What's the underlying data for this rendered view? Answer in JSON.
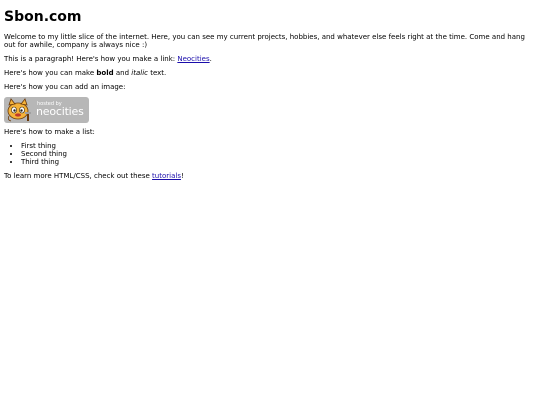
{
  "page": {
    "title": "Sbon.com",
    "intro": "Welcome to my little slice of the internet. Here, you can see my current projects, hobbies, and whatever else feels right at the time. Come and hang out for awhile, company is always nice :)",
    "paragraph_prefix": "This is a paragraph! Here's how you make a link: ",
    "link_label": "Neocities",
    "paragraph_suffix": ".",
    "bold_prefix": "Here's how you can make ",
    "bold_word": "bold",
    "and_word": " and ",
    "italic_word": "italic",
    "bold_suffix": " text.",
    "image_line": "Here's how you can add an image:",
    "badge_small": "hosted by",
    "badge_big": "neocities",
    "list_heading": "Here's how to make a list:",
    "list_items": [
      "First thing",
      "Second thing",
      "Third thing"
    ],
    "learn_prefix": "To learn more HTML/CSS, check out these ",
    "learn_link": "tutorials",
    "learn_suffix": "!"
  }
}
